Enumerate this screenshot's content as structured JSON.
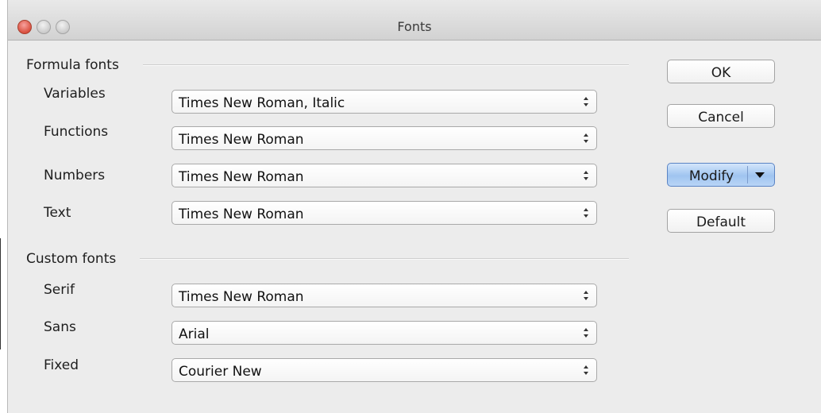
{
  "window": {
    "title": "Fonts"
  },
  "formula_fonts": {
    "heading": "Formula fonts",
    "rows": [
      {
        "label": "Variables",
        "value": "Times New Roman, Italic"
      },
      {
        "label": "Functions",
        "value": "Times New Roman"
      },
      {
        "label": "Numbers",
        "value": "Times New Roman"
      },
      {
        "label": "Text",
        "value": "Times New Roman"
      }
    ]
  },
  "custom_fonts": {
    "heading": "Custom fonts",
    "rows": [
      {
        "label": "Serif",
        "value": "Times New Roman"
      },
      {
        "label": "Sans",
        "value": "Arial"
      },
      {
        "label": "Fixed",
        "value": "Courier New"
      }
    ]
  },
  "buttons": {
    "ok": "OK",
    "cancel": "Cancel",
    "modify": "Modify",
    "default": "Default"
  },
  "icons": {
    "close": "close-icon",
    "minimize": "minimize-icon",
    "zoom": "zoom-icon",
    "stepper": "updown-stepper-icon",
    "dropdown": "triangle-down-icon"
  },
  "colors": {
    "window_bg": "#ececec",
    "close_button": "#d9503f",
    "default_button_accent": "#9fc4f0"
  }
}
